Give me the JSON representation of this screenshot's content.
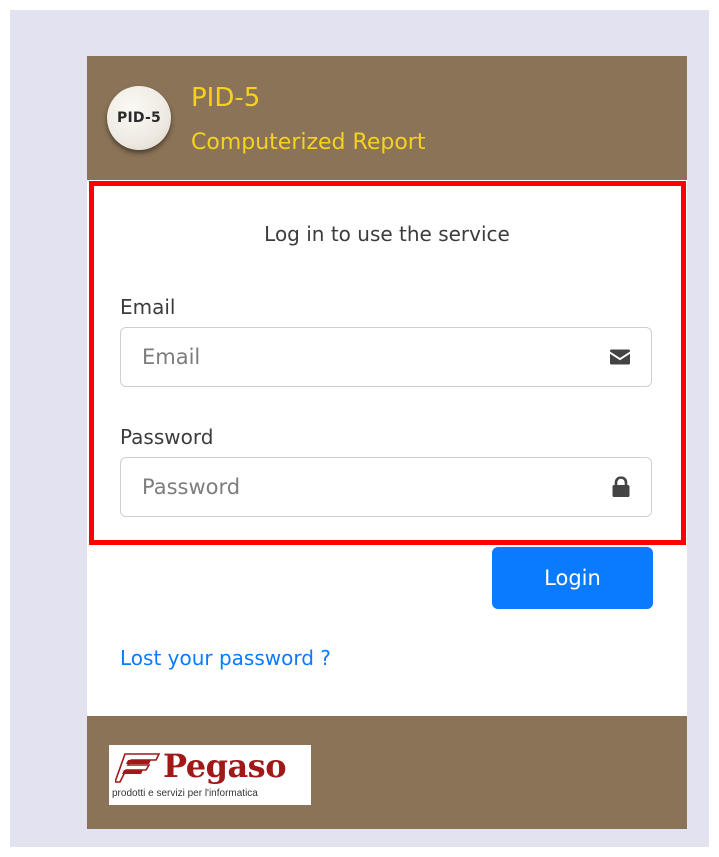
{
  "header": {
    "logo_text": "PID-5",
    "title": "PID-5",
    "subtitle": "Computerized Report"
  },
  "login": {
    "heading": "Log in to use the service",
    "email": {
      "label": "Email",
      "placeholder": "Email",
      "value": "",
      "icon": "envelope-icon"
    },
    "password": {
      "label": "Password",
      "placeholder": "Password",
      "value": "",
      "icon": "lock-icon"
    },
    "login_button": "Login",
    "lost_password_link": "Lost your password ?"
  },
  "footer": {
    "company_name": "Pegaso",
    "company_tagline": "prodotti e servizi per l'informatica"
  },
  "colors": {
    "brand_brown": "#8a7357",
    "title_yellow": "#f6d21f",
    "accent_blue": "#0a7bff",
    "highlight_red": "#ff0000",
    "page_background": "#e3e2f1"
  }
}
